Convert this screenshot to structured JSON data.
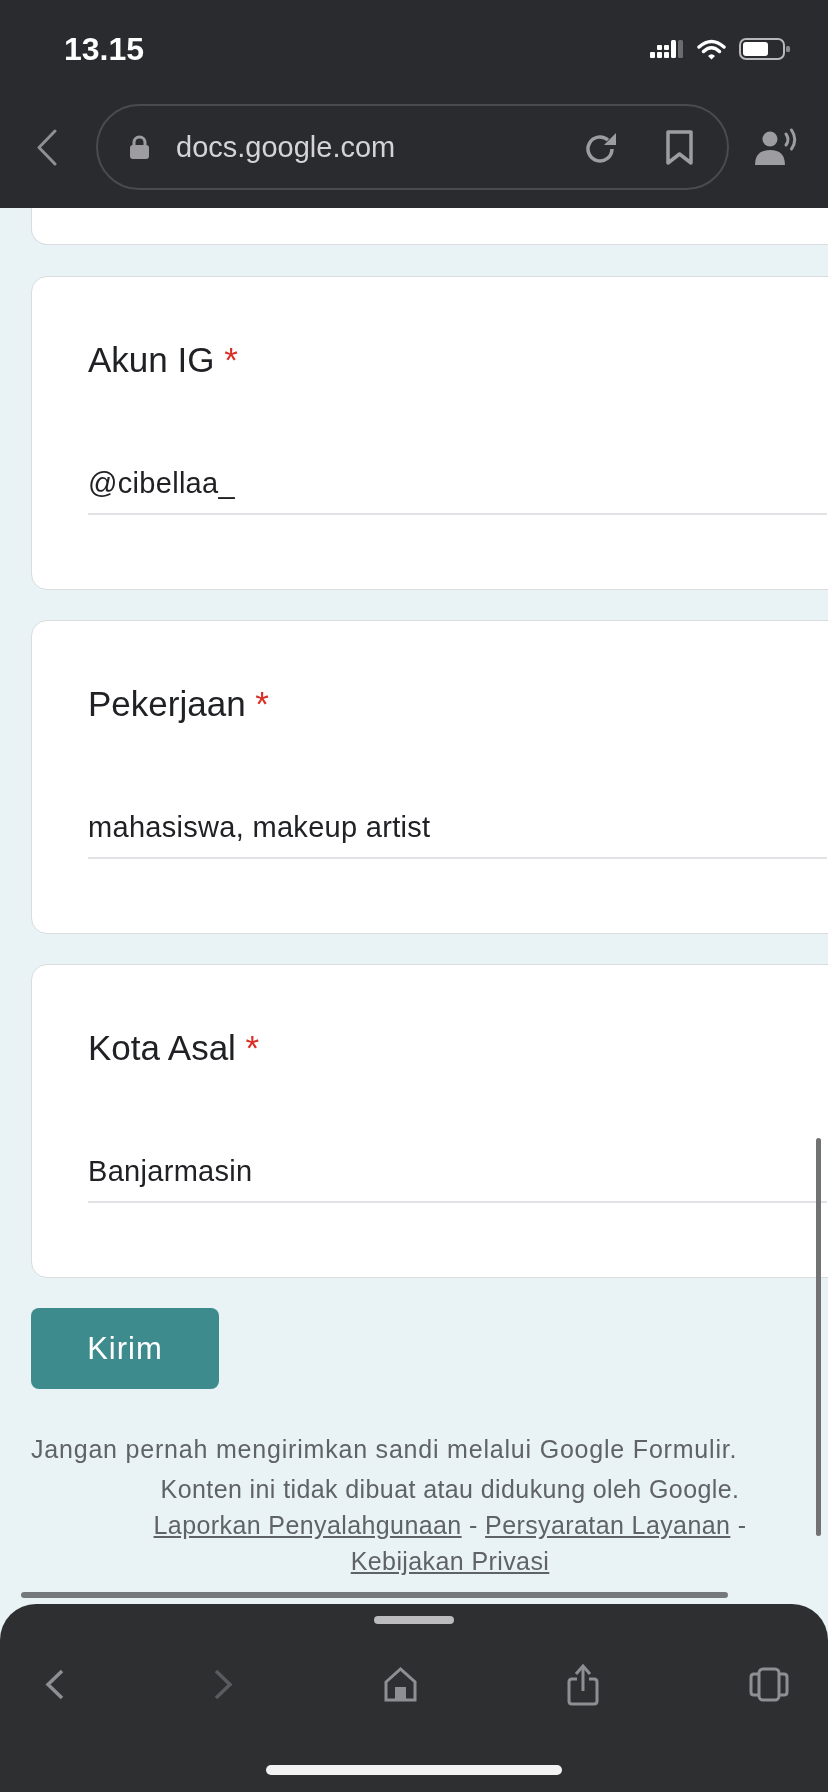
{
  "status_bar": {
    "time": "13.15"
  },
  "browser_bar": {
    "url": "docs.google.com"
  },
  "form": {
    "questions": [
      {
        "title": "Akun IG",
        "required_mark": "*",
        "value": "@cibellaa_"
      },
      {
        "title": "Pekerjaan",
        "required_mark": "*",
        "value": "mahasiswa, makeup artist"
      },
      {
        "title": "Kota Asal",
        "required_mark": "*",
        "value": "Banjarmasin"
      }
    ],
    "submit_button": "Kirim",
    "password_warning": "Jangan pernah mengirimkan sandi melalui Google Formulir.",
    "footer": [
      {
        "kind": "text",
        "text": "Konten ini tidak dibuat atau didukung oleh Google."
      },
      {
        "kind": "link",
        "text": "Laporkan Penyalahgunaan"
      },
      {
        "kind": "separator",
        "text": "-"
      },
      {
        "kind": "link",
        "text": "Persyaratan Layanan"
      },
      {
        "kind": "separator",
        "text": "-"
      },
      {
        "kind": "link",
        "text": "Kebijakan Privasi"
      }
    ]
  },
  "bottom_toolbar": {
    "buttons": [
      {
        "kind": "back",
        "disabled": false
      },
      {
        "kind": "forward",
        "disabled": true
      },
      {
        "kind": "home",
        "disabled": false
      },
      {
        "kind": "share",
        "disabled": false
      },
      {
        "kind": "tabs",
        "disabled": false
      }
    ]
  }
}
